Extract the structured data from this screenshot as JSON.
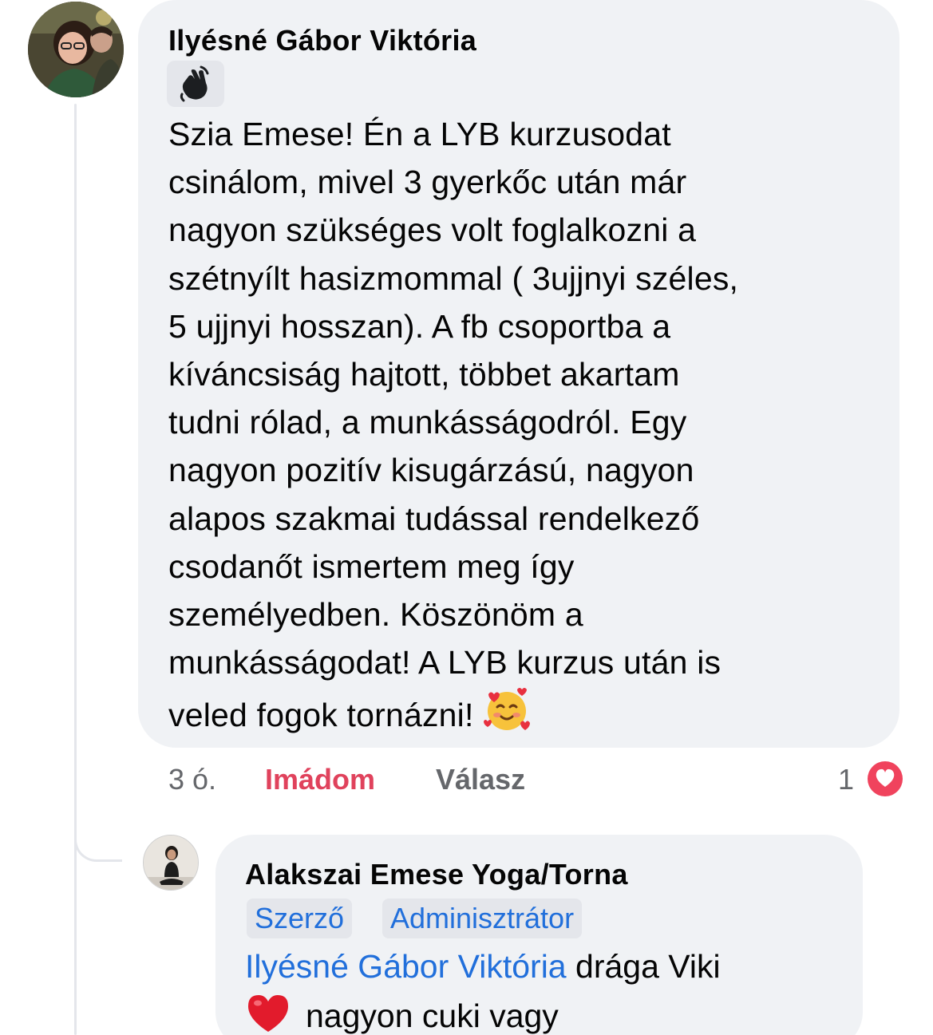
{
  "comment": {
    "author": "Ilyésné Gábor Viktória",
    "sticker_icon": "waving-hand-icon",
    "text": "Szia Emese! Én a LYB kurzusodat\ncsinálom, mivel 3 gyerkőc után már\nnagyon szükséges volt foglalkozni a\nszétnyílt hasizmommal ( 3ujjnyi széles,\n5 ujjnyi hosszan). A fb csoportba a\nkíváncsiság hajtott, többet akartam\ntudni rólad, a munkásságodról. Egy\nnagyon pozitív kisugárzású, nagyon\nalapos szakmai tudással rendelkező\ncsodanőt ismertem meg így\nszemélyedben. Köszönöm a\nmunkásságodat! A LYB kurzus után is\nveled fogok tornázni!",
    "trailing_emoji": "smiling-face-with-hearts-icon",
    "time": "3 ó.",
    "love_label": "Imádom",
    "reply_label": "Válasz",
    "reaction_count": "1",
    "reaction_icon": "love-reaction-icon"
  },
  "reply": {
    "author": "Alakszai Emese Yoga/Torna",
    "badges": [
      "Szerző",
      "Adminisztrátor"
    ],
    "mention": "Ilyésné Gábor Viktória",
    "text_after_mention": " drága Viki",
    "emoji": "red-heart-icon",
    "text_line2": "nagyon cuki vagy"
  },
  "colors": {
    "bubble": "#f0f2f5",
    "love": "#e0425c",
    "link": "#216fdb",
    "meta": "#65676b"
  }
}
